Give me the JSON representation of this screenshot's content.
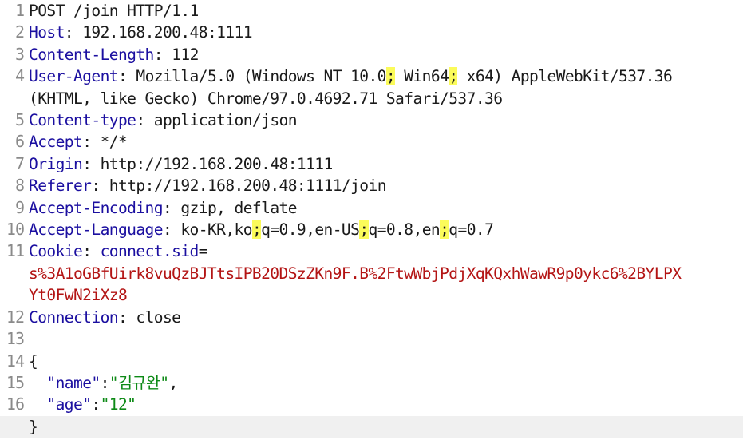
{
  "request": {
    "request_line": "POST /join HTTP/1.1",
    "headers": {
      "host": {
        "name": "Host",
        "sep": ": ",
        "value": "192.168.200.48:1111"
      },
      "content_length": {
        "name": "Content-Length",
        "sep": ": ",
        "value": "112"
      },
      "user_agent": {
        "name": "User-Agent",
        "sep": ": ",
        "value_a": "Mozilla/5.0 (Windows NT 10.0",
        "semi1": ";",
        "value_b": " Win64",
        "semi2": ";",
        "value_c": " x64) AppleWebKit/537.36",
        "value_d": "(KHTML, like Gecko) Chrome/97.0.4692.71 Safari/537.36"
      },
      "content_type": {
        "name": "Content-type",
        "sep": ": ",
        "value": "application/json"
      },
      "accept": {
        "name": "Accept",
        "sep": ": ",
        "value": "*/*"
      },
      "origin": {
        "name": "Origin",
        "sep": ": ",
        "value": "http://192.168.200.48:1111"
      },
      "referer": {
        "name": "Referer",
        "sep": ": ",
        "value": "http://192.168.200.48:1111/join"
      },
      "accept_encoding": {
        "name": "Accept-Encoding",
        "sep": ": ",
        "value": "gzip, deflate"
      },
      "accept_language": {
        "name": "Accept-Language",
        "sep": ": ",
        "v1": "ko-KR,ko",
        "semi1": ";",
        "v2": "q=0.9,en-US",
        "semi2": ";",
        "v3": "q=0.8,en",
        "semi3": ";",
        "v4": "q=0.7"
      },
      "cookie": {
        "name": "Cookie",
        "sep": ": ",
        "cookie_name": "connect.sid",
        "eq": "=",
        "cookie_value_1": "s%3A1oGBfUirk8vuQzBJTtsIPB20DSzZKn9F.B%2FtwWbjPdjXqKQxhWawR9p0ykc6%2BYLPX",
        "cookie_value_2": "Yt0FwN2iXz8"
      },
      "connection": {
        "name": "Connection",
        "sep": ": ",
        "value": "close"
      }
    },
    "body": {
      "open": "{",
      "name_key": "\"name\"",
      "colon": ":",
      "name_value": "\"김규완\"",
      "comma": ",",
      "age_key": "\"age\"",
      "age_value": "\"12\"",
      "close": "}"
    }
  },
  "line_numbers": [
    "1",
    "2",
    "3",
    "4",
    "5",
    "6",
    "7",
    "8",
    "9",
    "10",
    "11",
    "12",
    "13",
    "14",
    "15",
    "16"
  ]
}
